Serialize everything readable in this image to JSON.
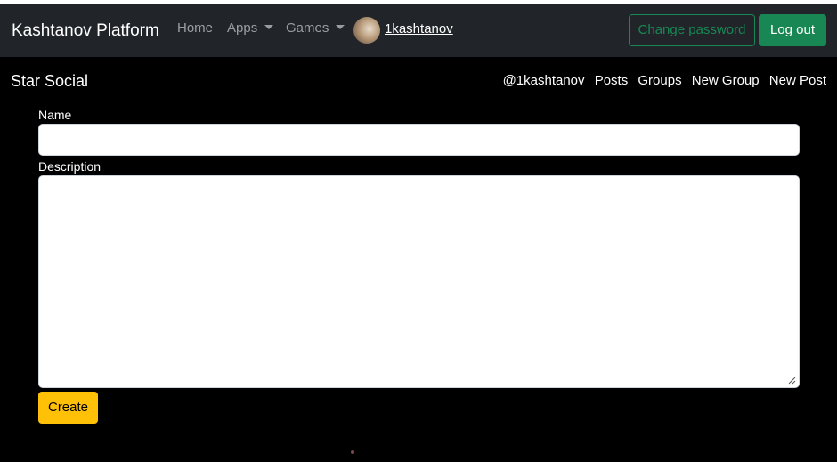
{
  "navbar": {
    "brand": "Kashtanov Platform",
    "links": {
      "home": "Home",
      "apps": "Apps",
      "games": "Games"
    },
    "username": "1kashtanov",
    "change_password": "Change password",
    "logout": "Log out"
  },
  "page": {
    "title": "Star Social",
    "subnav": {
      "handle": "@1kashtanov",
      "posts": "Posts",
      "groups": "Groups",
      "new_group": "New Group",
      "new_post": "New Post"
    }
  },
  "form": {
    "name_label": "Name",
    "name_value": "",
    "description_label": "Description",
    "description_value": "",
    "submit_label": "Create"
  },
  "colors": {
    "navbar_bg": "#212529",
    "success": "#198754",
    "warning": "#ffc107"
  }
}
